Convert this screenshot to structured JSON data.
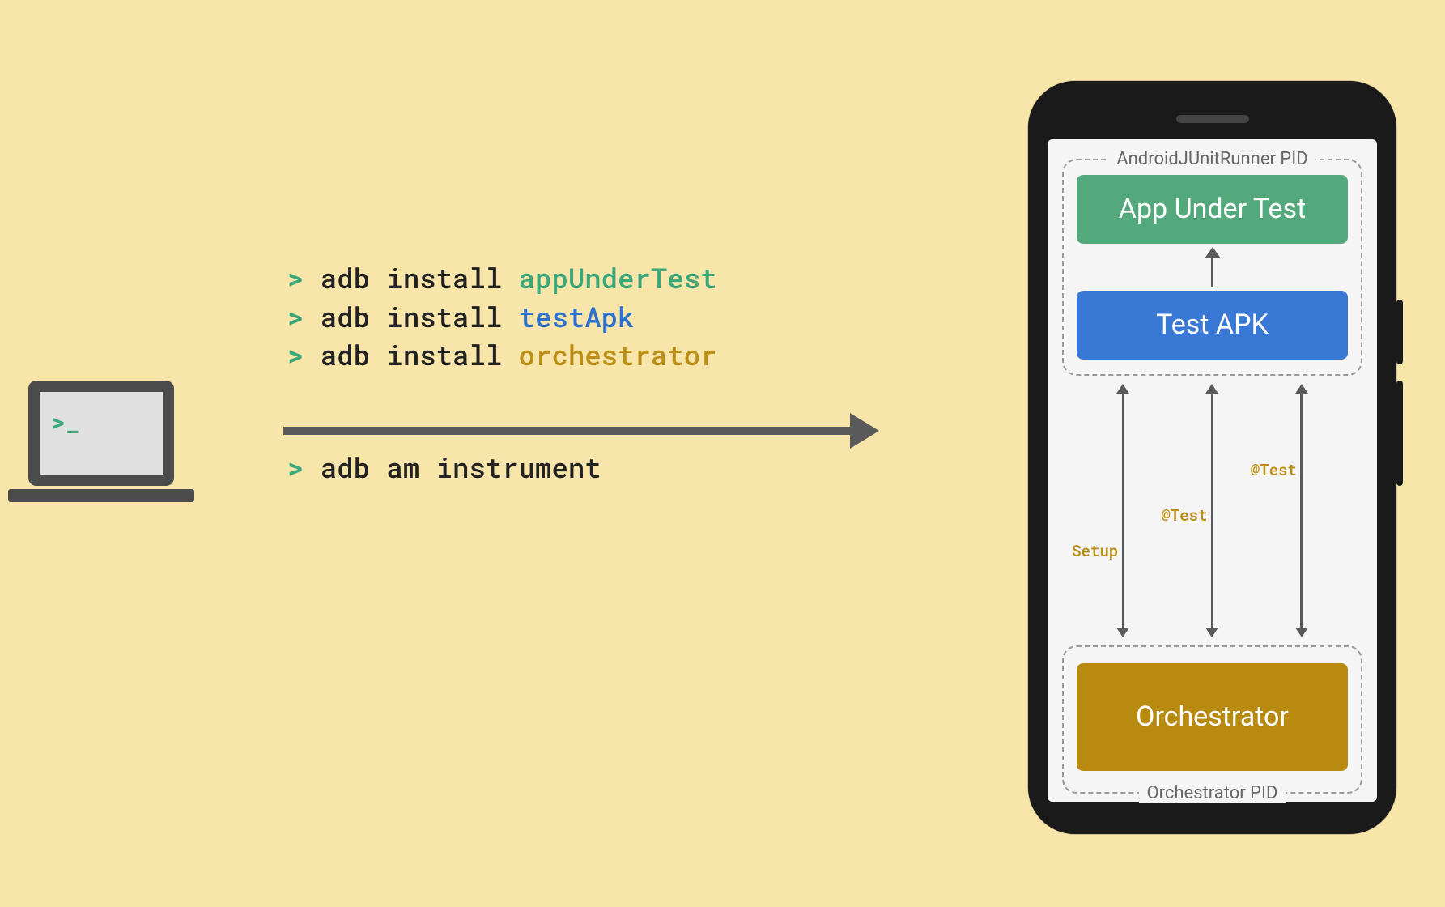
{
  "laptop": {
    "prompt_symbol": ">_"
  },
  "commands": {
    "line1": {
      "prompt": ">",
      "cmd": "adb install",
      "arg": "appUnderTest"
    },
    "line2": {
      "prompt": ">",
      "cmd": "adb install",
      "arg": "testApk"
    },
    "line3": {
      "prompt": ">",
      "cmd": "adb install",
      "arg": "orchestrator"
    },
    "line4": {
      "prompt": ">",
      "cmd": "adb am instrument"
    }
  },
  "phone": {
    "runner_pid_label": "AndroidJUnitRunner PID",
    "app_under_test": "App Under Test",
    "test_apk": "Test APK",
    "flows": {
      "setup": "Setup",
      "test1": "@Test",
      "test2": "@Test"
    },
    "orchestrator_pid_label": "Orchestrator PID",
    "orchestrator": "Orchestrator"
  },
  "colors": {
    "background": "#f7e5a9",
    "prompt_green": "#3aa87a",
    "arg_blue": "#2d70d0",
    "arg_yellow": "#bb8f16",
    "box_green": "#54a97c",
    "box_blue": "#3a78d6",
    "box_gold": "#b88a10",
    "arrow": "#5a5a5a"
  }
}
